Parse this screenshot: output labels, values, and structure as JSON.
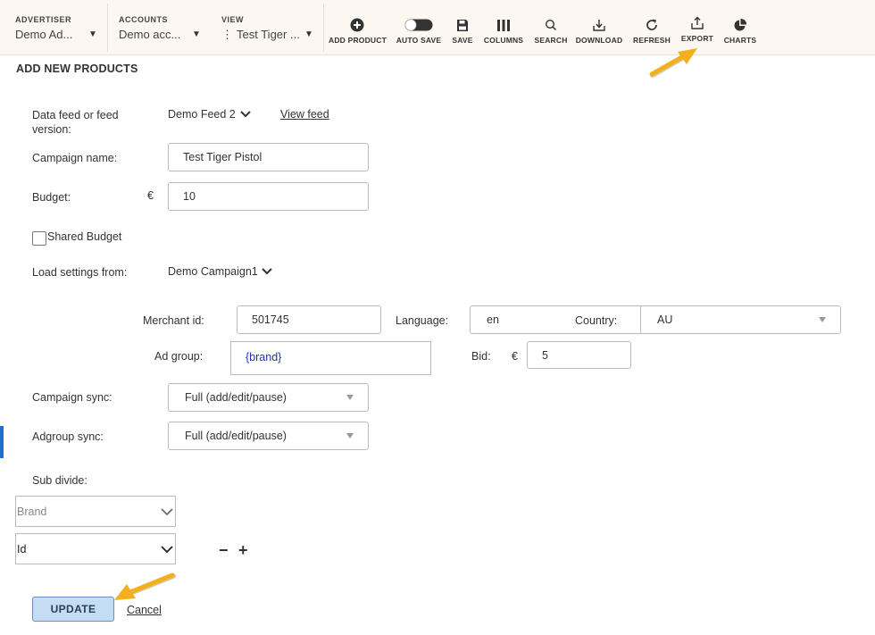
{
  "header": {
    "advertiser": {
      "caption": "ADVERTISER",
      "value": "Demo Ad..."
    },
    "accounts": {
      "caption": "ACCOUNTS",
      "value": "Demo acc..."
    },
    "view": {
      "caption": "VIEW",
      "value": "Test Tiger ..."
    },
    "tools": {
      "add_product": "ADD PRODUCT",
      "auto_save": "AUTO SAVE",
      "save": "SAVE",
      "columns": "COLUMNS",
      "search": "SEARCH",
      "download": "DOWNLOAD",
      "refresh": "REFRESH",
      "export": "EXPORT",
      "charts": "CHARTS"
    }
  },
  "form": {
    "title": "ADD NEW PRODUCTS",
    "data_feed_label": "Data feed or feed version:",
    "data_feed_value": "Demo Feed 2",
    "view_feed": "View feed",
    "campaign_name_label": "Campaign name:",
    "campaign_name_value": "Test Tiger Pistol",
    "budget_label": "Budget:",
    "currency": "€",
    "budget_value": "10",
    "shared_budget": "Shared Budget",
    "load_settings_label": "Load settings from:",
    "load_settings_value": "Demo Campaign1",
    "merchant_id_label": "Merchant id:",
    "merchant_id_value": "501745",
    "language_label": "Language:",
    "language_value": "en",
    "country_label": "Country:",
    "country_value": "AU",
    "ad_group_label": "Ad group:",
    "ad_group_value": "{brand}",
    "bid_label": "Bid:",
    "bid_value": "5",
    "campaign_sync_label": "Campaign sync:",
    "campaign_sync_value": "Full (add/edit/pause)",
    "adgroup_sync_label": "Adgroup sync:",
    "adgroup_sync_value": "Full (add/edit/pause)",
    "sub_divide_label": "Sub divide:",
    "sub_divide_1": "Brand",
    "sub_divide_2": "Id",
    "minus": "−",
    "plus": "+",
    "update": "UPDATE",
    "cancel": "Cancel"
  },
  "colors": {
    "accent": "#1f6fd1",
    "annotation_arrow": "#f2b01e",
    "header_bg": "#fdf7f2",
    "update_bg": "#c5dcf5",
    "ad_group_text": "#2233aa"
  }
}
